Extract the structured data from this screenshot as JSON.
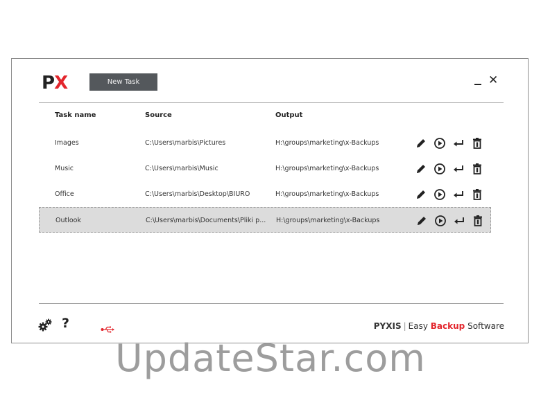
{
  "logo": {
    "p": "P",
    "x": "X"
  },
  "toolbar": {
    "new_task_label": "New Task"
  },
  "window": {
    "minimize": "_",
    "close": "✕"
  },
  "table": {
    "headers": {
      "name": "Task name",
      "source": "Source",
      "output": "Output"
    },
    "rows": [
      {
        "name": "Images",
        "source": "C:\\Users\\marbis\\Pictures",
        "output": "H:\\groups\\marketing\\x-Backups",
        "selected": false
      },
      {
        "name": "Music",
        "source": "C:\\Users\\marbis\\Music",
        "output": "H:\\groups\\marketing\\x-Backups",
        "selected": false
      },
      {
        "name": "Office",
        "source": "C:\\Users\\marbis\\Desktop\\BIURO",
        "output": "H:\\groups\\marketing\\x-Backups",
        "selected": false
      },
      {
        "name": "Outlook",
        "source": "C:\\Users\\marbis\\Documents\\Pliki p...",
        "output": "H:\\groups\\marketing\\x-Backups",
        "selected": true
      }
    ],
    "row_actions": [
      "pencil-icon",
      "play-icon",
      "restore-icon",
      "trash-icon"
    ]
  },
  "footer": {
    "help": "?",
    "brand_name": "PYXIS",
    "brand_sep": "|",
    "brand_easy": "Easy",
    "brand_backup": "Backup",
    "brand_software": "Software"
  },
  "watermark": "UpdateStar.com",
  "colors": {
    "accent_red": "#e3262d",
    "button_dark": "#54585c",
    "selected_row": "#dcdcdc"
  }
}
